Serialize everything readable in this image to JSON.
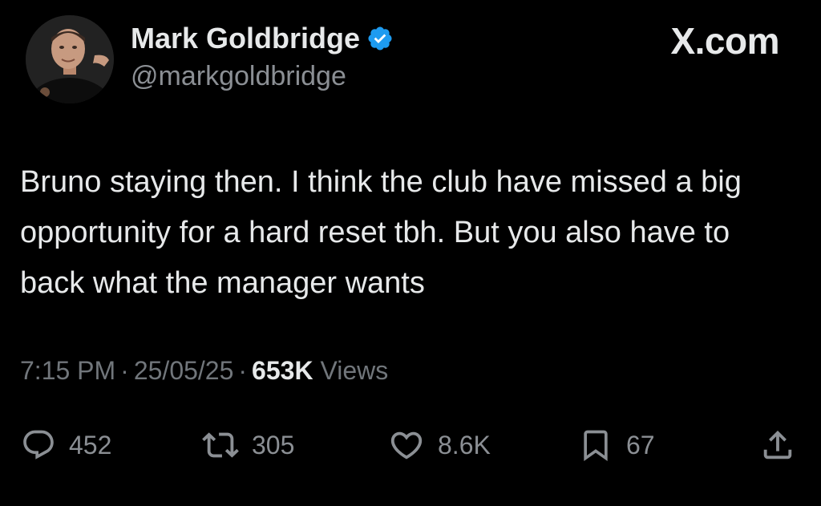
{
  "author": {
    "name": "Mark Goldbridge",
    "handle": "@markgoldbridge",
    "verified": true,
    "verified_color": "#1d9bf0"
  },
  "brand": "X.com",
  "tweet": {
    "text": "Bruno staying then. I think the club have missed a big opportunity for a hard reset tbh. But you also have to back what the manager wants"
  },
  "meta": {
    "time": "7:15 PM",
    "separator": "·",
    "date": "25/05/25",
    "views_count": "653K",
    "views_label": "Views"
  },
  "actions": {
    "replies": "452",
    "reposts": "305",
    "likes": "8.6K",
    "bookmarks": "67"
  },
  "icons": {
    "reply": "reply-icon",
    "repost": "repost-icon",
    "like": "heart-icon",
    "bookmark": "bookmark-icon",
    "share": "share-icon",
    "verified": "verified-badge-icon"
  },
  "colors": {
    "background": "#000000",
    "text_primary": "#e7e9ea",
    "text_secondary": "#71767b"
  }
}
